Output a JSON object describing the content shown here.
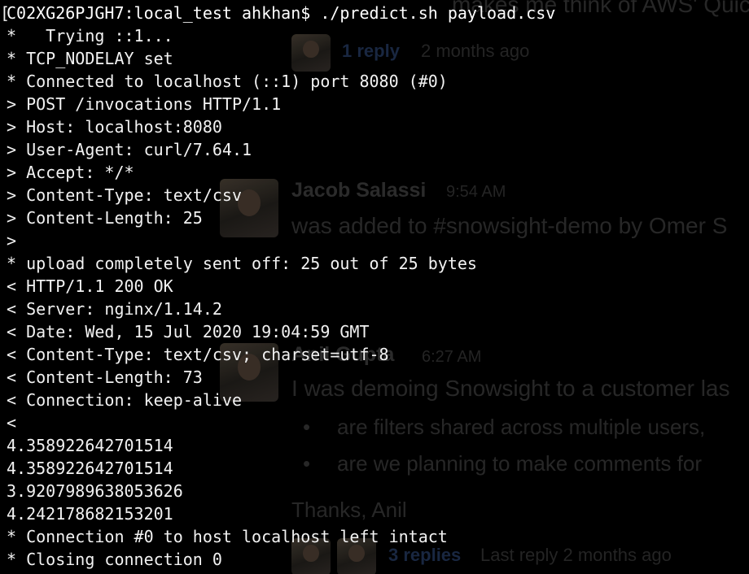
{
  "terminal": {
    "prompt_bracket": "[",
    "lines": [
      "C02XG26PJGH7:local_test ahkhan$ ./predict.sh payload.csv",
      "*   Trying ::1...",
      "* TCP_NODELAY set",
      "* Connected to localhost (::1) port 8080 (#0)",
      "> POST /invocations HTTP/1.1",
      "> Host: localhost:8080",
      "> User-Agent: curl/7.64.1",
      "> Accept: */*",
      "> Content-Type: text/csv",
      "> Content-Length: 25",
      ">",
      "* upload completely sent off: 25 out of 25 bytes",
      "< HTTP/1.1 200 OK",
      "< Server: nginx/1.14.2",
      "< Date: Wed, 15 Jul 2020 19:04:59 GMT",
      "< Content-Type: text/csv; charset=utf-8",
      "< Content-Length: 73",
      "< Connection: keep-alive",
      "<",
      "4.358922642701514",
      "4.358922642701514",
      "3.9207989638053626",
      "4.242178682153201",
      "* Connection #0 to host localhost left intact",
      "* Closing connection 0"
    ]
  },
  "background_slack": {
    "top_message_tail": "makes me think of AWS' Quicksight.",
    "thread1": {
      "replies": "1 reply",
      "when": "2 months ago"
    },
    "msg1": {
      "author": "Jacob Salassi",
      "time": "9:54 AM",
      "text": "was added to #snowsight-demo by Omer S"
    },
    "msg2": {
      "author": "Anil Gupta",
      "time": "6:27 AM",
      "text": "I was demoing Snowsight to a customer las",
      "bullets": [
        "are filters shared across multiple users,",
        "are we planning to make comments for"
      ],
      "signoff": "Thanks, Anil"
    },
    "thread2": {
      "replies": "3 replies",
      "when": "Last reply 2 months ago"
    }
  }
}
